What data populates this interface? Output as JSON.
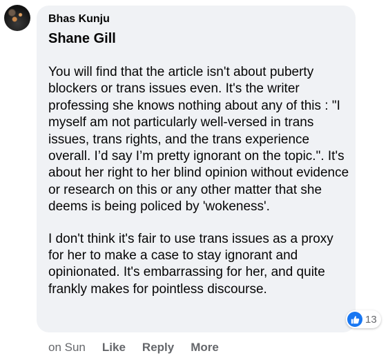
{
  "comment": {
    "author": "Bhas Kunju",
    "mention": "Shane Gill",
    "paragraphs": [
      "You will find that the article isn't about puberty blockers or trans issues even. It's the writer professing she knows nothing about any of this : \"I myself am not particularly well-versed in trans issues, trans rights, and the trans experience overall. I’d say I’m pretty ignorant on the topic.\". It's about her right to her blind opinion without evidence or research on this or any other matter that she deems is being policed by 'wokeness'.",
      "I don't think it's fair to use trans issues as a proxy for her to make a case to stay ignorant and opinionated. It's embarrassing for her, and quite frankly makes for pointless discourse."
    ],
    "reactions": {
      "icon": "like-icon",
      "count": "13",
      "color": "#1877f2"
    },
    "timestamp": "on Sun",
    "actions": {
      "like": "Like",
      "reply": "Reply",
      "more": "More"
    }
  }
}
